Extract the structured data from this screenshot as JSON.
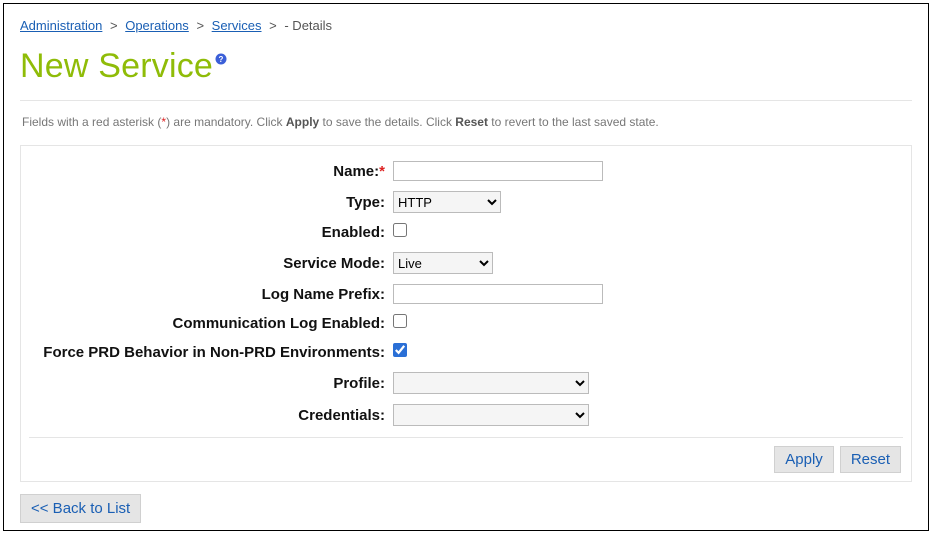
{
  "breadcrumb": {
    "items": [
      {
        "label": "Administration",
        "link": true
      },
      {
        "label": "Operations",
        "link": true
      },
      {
        "label": "Services",
        "link": true
      }
    ],
    "final": "- Details"
  },
  "page": {
    "title": "New Service"
  },
  "hint": {
    "before_asterisk": "Fields with a red asterisk (",
    "asterisk": "*",
    "after_asterisk": ") are mandatory. Click ",
    "apply_word": "Apply",
    "mid": " to save the details. Click ",
    "reset_word": "Reset",
    "after": " to revert to the last saved state."
  },
  "form": {
    "name": {
      "label": "Name:",
      "required": "*",
      "value": ""
    },
    "type": {
      "label": "Type:",
      "value": "HTTP"
    },
    "enabled": {
      "label": "Enabled:",
      "checked": false
    },
    "service_mode": {
      "label": "Service Mode:",
      "value": "Live"
    },
    "log_prefix": {
      "label": "Log Name Prefix:",
      "value": ""
    },
    "comm_log": {
      "label": "Communication Log Enabled:",
      "checked": false
    },
    "force_prd": {
      "label": "Force PRD Behavior in Non-PRD Environments:",
      "checked": true
    },
    "profile": {
      "label": "Profile:",
      "value": ""
    },
    "credentials": {
      "label": "Credentials:",
      "value": ""
    }
  },
  "actions": {
    "apply": "Apply",
    "reset": "Reset",
    "back": "<< Back to List"
  }
}
